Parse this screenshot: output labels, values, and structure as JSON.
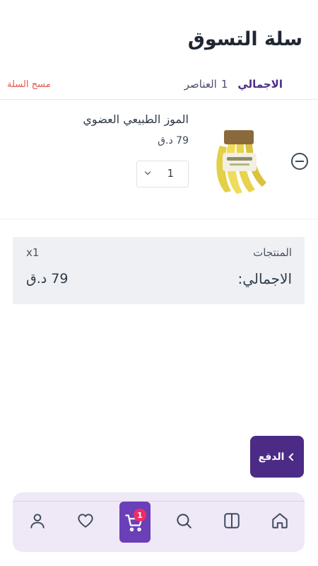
{
  "header": {
    "title": "سلة التسوق"
  },
  "summary": {
    "total_label": "الاجمالي",
    "items_count": "1",
    "items_label": "العناصر",
    "clear_cart": "مسح السلة"
  },
  "cart_items": [
    {
      "name": "الموز الطبيعي العضوي",
      "price": "79 د.ق",
      "quantity": "1",
      "image_icon": "banana-bunch-image"
    }
  ],
  "totals": {
    "products_label": "المنتجات",
    "products_count": "x1",
    "total_label": "الاجمالي:",
    "total_value": "79 د.ق"
  },
  "checkout": {
    "label": "الدفع"
  },
  "bottom_nav": {
    "cart_badge": "1",
    "items": [
      "profile-icon",
      "heart-icon",
      "cart-icon",
      "search-icon",
      "catalog-icon",
      "home-icon"
    ]
  },
  "colors": {
    "brand": "#4b2b86",
    "cart_active": "#6b3fb8",
    "badge": "#f02d63",
    "clear_link": "#e2574c",
    "nav_bg": "#efe8f7",
    "totals_bg": "#eef0f3"
  }
}
